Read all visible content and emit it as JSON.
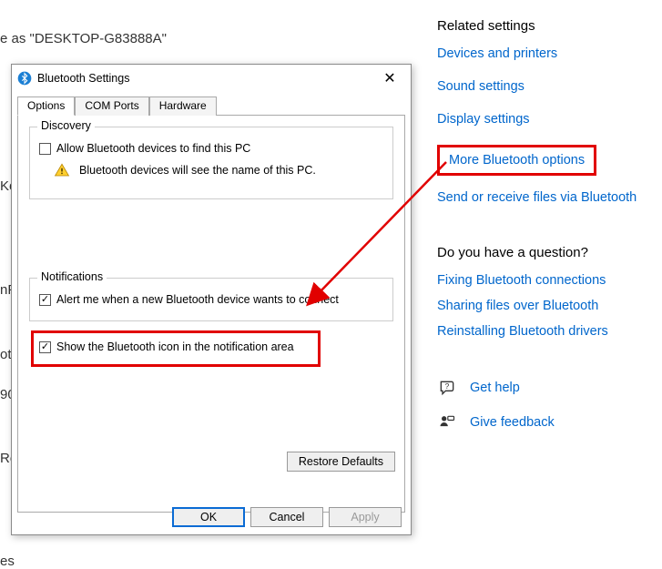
{
  "background": {
    "discoverable_text": "e as \"DESKTOP-G83888A\"",
    "left_fragments": [
      "Ke",
      "nP",
      "ot",
      "90",
      "Re",
      "es"
    ]
  },
  "dialog": {
    "title": "Bluetooth Settings",
    "tabs": {
      "options": "Options",
      "com": "COM Ports",
      "hw": "Hardware"
    },
    "discovery": {
      "legend": "Discovery",
      "allow": "Allow Bluetooth devices to find this PC",
      "note": "Bluetooth devices will see the name of this PC."
    },
    "notifications": {
      "legend": "Notifications",
      "alert": "Alert me when a new Bluetooth device wants to connect"
    },
    "show_icon": "Show the Bluetooth icon in the notification area",
    "restore": "Restore Defaults",
    "ok": "OK",
    "cancel": "Cancel",
    "apply": "Apply"
  },
  "right": {
    "related_heading": "Related settings",
    "devices": "Devices and printers",
    "sound": "Sound settings",
    "display": "Display settings",
    "more_bt": "More Bluetooth options",
    "send_recv": "Send or receive files via Bluetooth",
    "question_heading": "Do you have a question?",
    "fix_bt": "Fixing Bluetooth connections",
    "share_bt": "Sharing files over Bluetooth",
    "reinstall_bt": "Reinstalling Bluetooth drivers",
    "get_help": "Get help",
    "give_feedback": "Give feedback"
  }
}
